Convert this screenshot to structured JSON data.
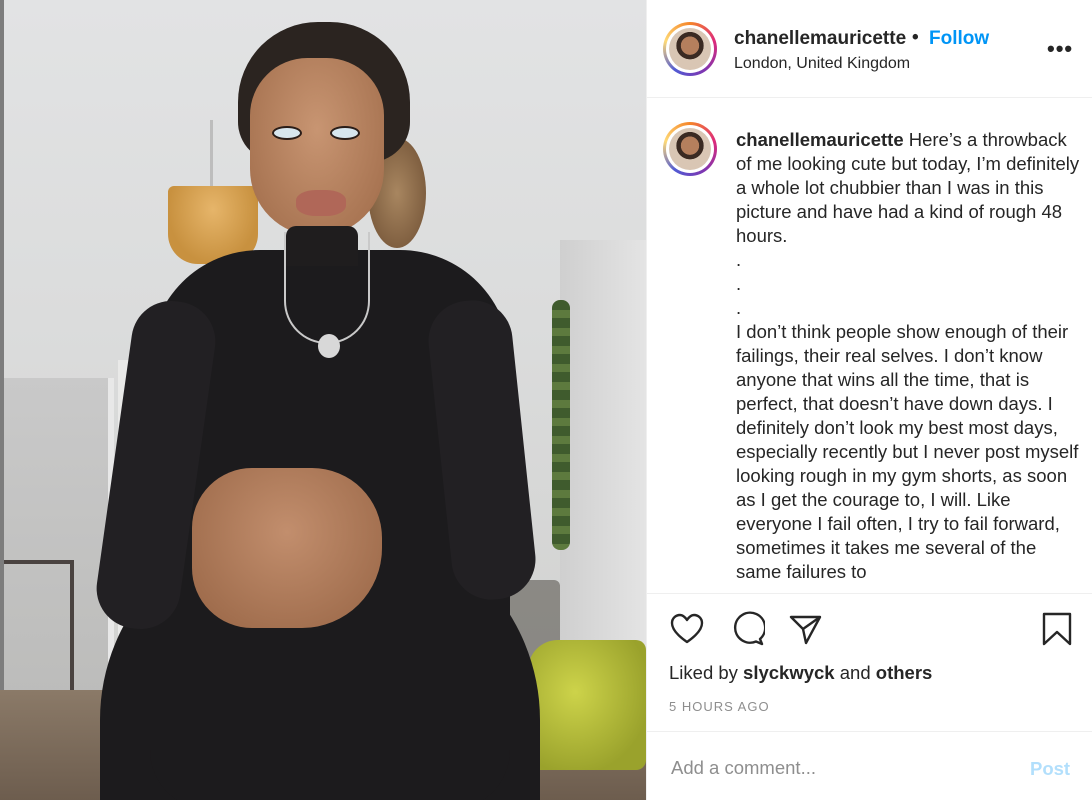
{
  "post": {
    "username": "chanellemauricette",
    "separator": "•",
    "follow_label": "Follow",
    "location": "London, United Kingdom",
    "more_label": "•••",
    "caption": {
      "username": "chanellemauricette",
      "text": " Here’s a throwback of me looking cute but today, I’m definitely a whole lot chubbier than I was in this picture and have had a kind of rough 48 hours.\n.\n.\n.\nI don’t think people show enough of their failings, their real selves. I don’t know anyone that wins all the time, that is perfect, that doesn’t have down days. I definitely don’t look my best most days, especially recently but I never post myself looking rough in my gym shorts, as soon as I get the courage to, I will. Like everyone I fail often, I try to fail forward, sometimes it takes me several of the same failures to"
    },
    "likes": {
      "prefix": "Liked by",
      "user": "slyckwyck",
      "conjunction": "and",
      "others": "others"
    },
    "timestamp": "5 HOURS AGO",
    "comment": {
      "placeholder": "Add a comment...",
      "post_label": "Post"
    },
    "icons": {
      "like": "heart-icon",
      "comment": "comment-bubble-icon",
      "share": "paper-plane-icon",
      "save": "bookmark-icon"
    },
    "colors": {
      "follow": "#0095f6",
      "post_disabled": "#b2dffc",
      "muted": "#8e8e8e",
      "text": "#262626"
    }
  }
}
